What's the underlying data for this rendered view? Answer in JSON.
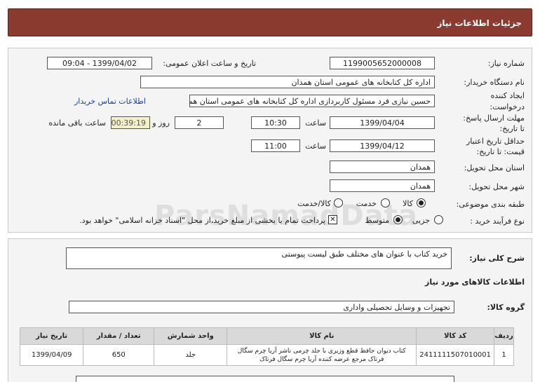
{
  "header": {
    "title": "جزئیات اطلاعات نیاز"
  },
  "fields": {
    "need_number_label": "شماره نیاز:",
    "need_number": "1199005652000008",
    "announce_label": "تاریخ و ساعت اعلان عمومی:",
    "announce_value": "1399/04/02 - 09:04",
    "buyer_label": "نام دستگاه خریدار:",
    "buyer_value": "اداره کل کتابخانه های عمومی استان همدان",
    "creator_label_1": "ایجاد کننده",
    "creator_label_2": "درخواست:",
    "creator_value": "حسین نیازی فرد مسئول کاربردازی اداره کل کتابخانه های عمومی استان همدان",
    "contact_link": "اطلاعات تماس خریدار",
    "deadline_label_1": "مهلت ارسال پاسخ:",
    "deadline_label_2": "تا تاریخ:",
    "deadline_date": "1399/04/04",
    "time_label": "ساعت",
    "deadline_time": "10:30",
    "days_value": "2",
    "days_label": "روز و",
    "remaining_time": "00:39:19",
    "remaining_label": "ساعت باقی مانده",
    "validity_label_1": "حداقل تاریخ اعتبار",
    "validity_label_2": "قیمت: تا تاریخ:",
    "validity_date": "1399/04/12",
    "validity_time_label": "ساعت",
    "validity_time": "11:00",
    "province_label": "استان محل تحویل:",
    "province_value": "همدان",
    "city_label": "شهر محل تحویل:",
    "city_value": "همدان",
    "category_label": "طبقه بندی موضوعی:",
    "category_options": [
      "کالا",
      "خدمت",
      "کالا/خدمت"
    ],
    "process_label": "نوع فرآیند خرید :",
    "process_options": [
      "جزیی",
      "متوسط"
    ],
    "payment_note": "پرداخت تمام یا بخشی از مبلغ خرید،از محل \"اسناد خزانه اسلامی\" خواهد بود."
  },
  "summary": {
    "label": "شرح کلی نیاز:",
    "value": "خرید کتاب با عنوان های مختلف طبق لیست پیوستی"
  },
  "goods": {
    "section_title": "اطلاعات کالاهای مورد نیاز",
    "group_label": "گروه کالا:",
    "group_value": "تجهیزات و وسایل تحصیلی واداری",
    "columns": [
      "ردیف",
      "کد کالا",
      "نام کالا",
      "واحد شمارش",
      "تعداد / مقدار",
      "تاریخ نیاز"
    ],
    "rows": [
      {
        "row": "1",
        "code": "2411111507010001",
        "name": "کتاب دیوان حافظ قطع وزیری با جلد چرمی ناشر آریا چرم سگال فرتاک مرجع عرضه کننده آریا چرم سگال فرتاک",
        "unit": "جلد",
        "qty": "650",
        "date": "1399/04/09"
      }
    ]
  },
  "watermark": "ParsNamadData"
}
